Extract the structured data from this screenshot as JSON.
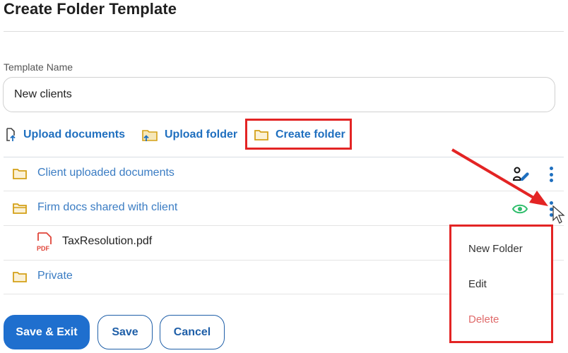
{
  "page": {
    "title": "Create Folder Template"
  },
  "form": {
    "template_name_label": "Template Name",
    "template_name_value": "New clients"
  },
  "actions": {
    "upload_documents": "Upload documents",
    "upload_folder": "Upload folder",
    "create_folder": "Create folder"
  },
  "folders": [
    {
      "label": "Client uploaded documents",
      "indicator_icon": "client-access-icon"
    },
    {
      "label": "Firm docs shared with client",
      "indicator_icon": "eye-icon"
    },
    {
      "label": "TaxResolution.pdf",
      "type": "file",
      "file_badge": "PDF"
    },
    {
      "label": "Private"
    }
  ],
  "context_menu": {
    "items": [
      "New Folder",
      "Edit",
      "Delete"
    ]
  },
  "buttons": {
    "save_exit": "Save & Exit",
    "save": "Save",
    "cancel": "Cancel"
  },
  "colors": {
    "link_blue": "#1f6fbf",
    "folder_gold": "#d4a017",
    "highlight_red": "#e32424",
    "eye_green": "#2ebd6b",
    "delete_red": "#e06b6b",
    "primary_button": "#1f6fce"
  }
}
